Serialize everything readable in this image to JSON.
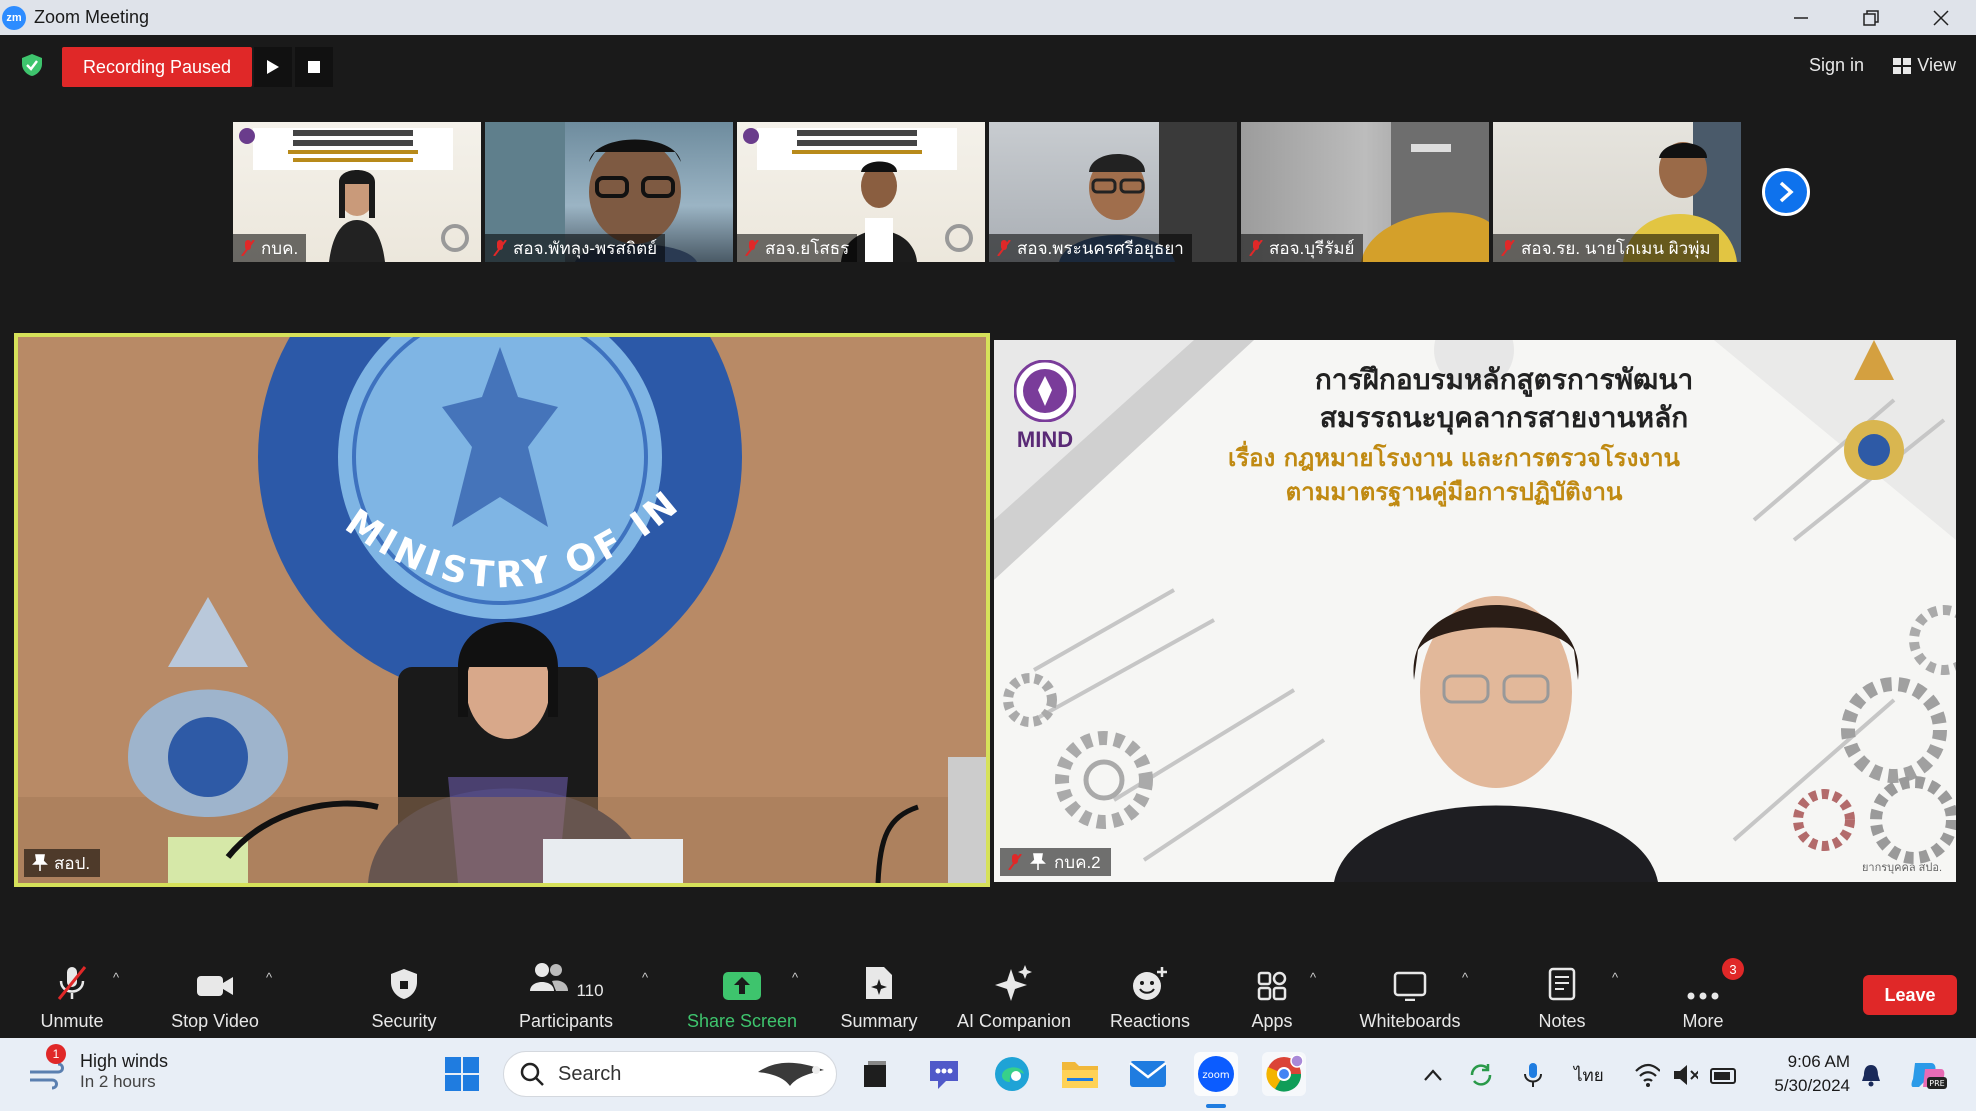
{
  "window": {
    "title": "Zoom Meeting",
    "logo": "zm",
    "controls": [
      "minimize-icon",
      "restore-icon",
      "close-icon"
    ]
  },
  "topbar": {
    "recording_label": "Recording Paused",
    "sign_in": "Sign in",
    "view": "View",
    "colors": {
      "recording": "#e02828",
      "shield": "#3ec46d"
    }
  },
  "thumbnails": [
    {
      "name": "กบค."
    },
    {
      "name": "สอจ.พัทลุง-พรสถิตย์"
    },
    {
      "name": "สอจ.ยโสธร"
    },
    {
      "name": "สอจ.พระนครศรีอยุธยา"
    },
    {
      "name": "สอจ.บุรีรัมย์"
    },
    {
      "name": "สอจ.รย. นายโกเมน ผิวพุ่ม"
    }
  ],
  "main_tiles": {
    "left": {
      "name": "สอป.",
      "seal_text": "MINISTRY OF INDUSTRY",
      "highlight_color": "#d6e15a"
    },
    "right": {
      "name": "กบค.2",
      "slide": {
        "logo_text": "MIND",
        "title_line1": "การฝึกอบรมหลักสูตรการพัฒนา",
        "title_line2": "สมรรถนะบุคลากรสายงานหลัก",
        "subtitle_line1": "เรื่อง กฎหมายโรงงาน และการตรวจโรงงาน",
        "subtitle_line2": "ตามมาตรฐานคู่มือการปฏิบัติงาน",
        "credit": "ยากรบุคคล สปอ."
      }
    }
  },
  "toolbar": {
    "unmute": "Unmute",
    "stop_video": "Stop Video",
    "security": "Security",
    "participants": "Participants",
    "participants_count": "110",
    "share_screen": "Share Screen",
    "summary": "Summary",
    "ai_companion": "AI Companion",
    "reactions": "Reactions",
    "apps": "Apps",
    "whiteboards": "Whiteboards",
    "notes": "Notes",
    "more": "More",
    "more_badge": "3",
    "leave": "Leave",
    "share_color": "#3ec46d"
  },
  "taskbar": {
    "weather_badge": "1",
    "weather_title": "High winds",
    "weather_sub": "In 2 hours",
    "search_placeholder": "Search",
    "language": "ไทย",
    "time": "9:06 AM",
    "date": "5/30/2024",
    "apps": [
      "windows-start-icon",
      "task-view-icon",
      "teams-icon",
      "edge-icon",
      "file-explorer-icon",
      "mail-icon",
      "zoom-icon",
      "chrome-icon"
    ],
    "tray": [
      "chevron-up-icon",
      "sync-icon",
      "microphone-icon",
      "wifi-icon",
      "speaker-muted-icon",
      "battery-icon",
      "notification-bell-icon",
      "copilot-icon"
    ]
  }
}
